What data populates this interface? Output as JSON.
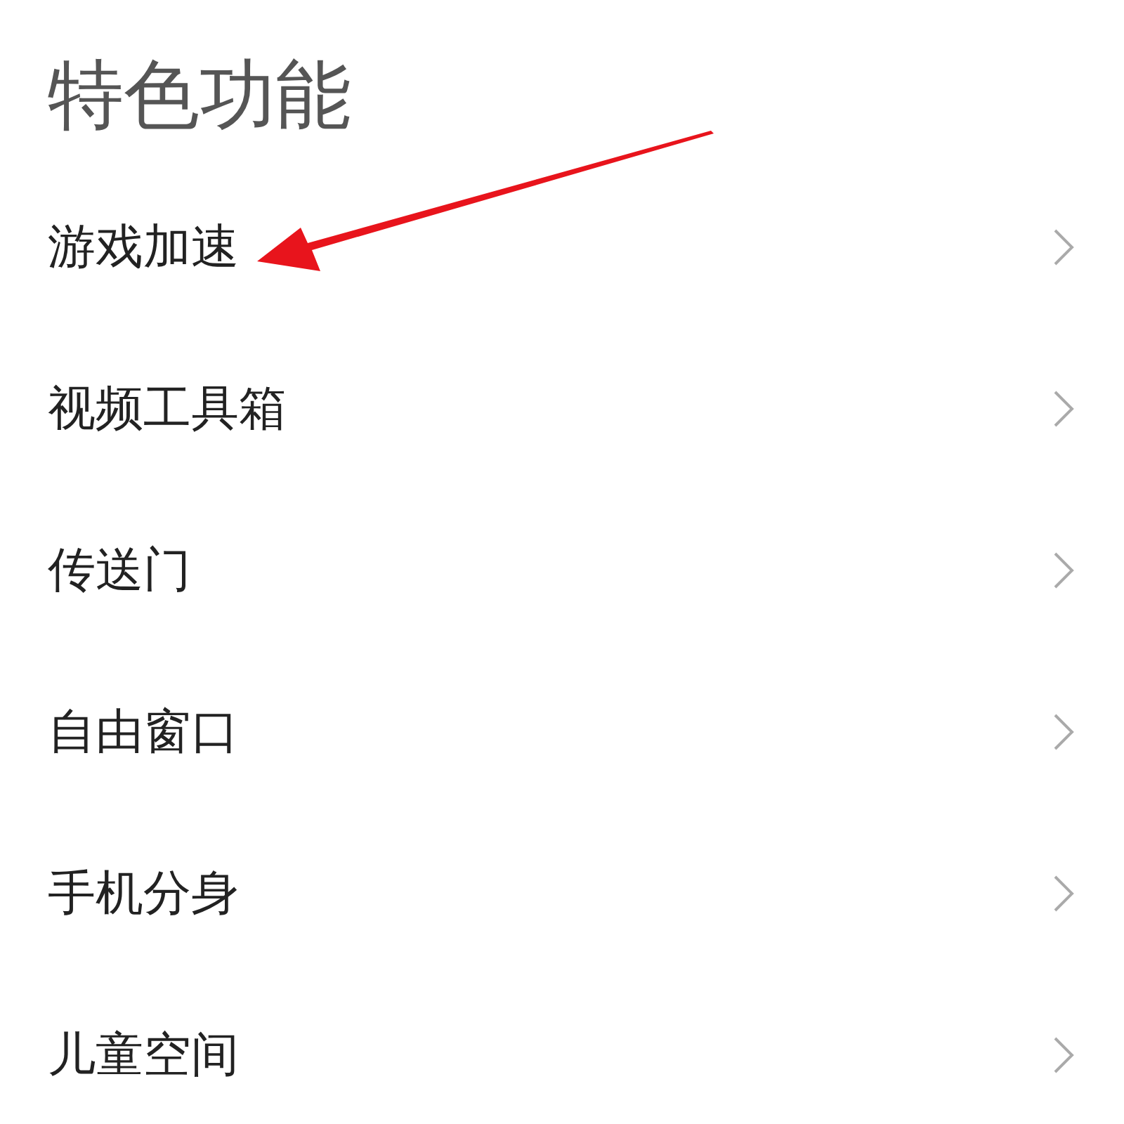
{
  "title": "特色功能",
  "items": [
    {
      "label": "游戏加速"
    },
    {
      "label": "视频工具箱"
    },
    {
      "label": "传送门"
    },
    {
      "label": "自由窗口"
    },
    {
      "label": "手机分身"
    },
    {
      "label": "儿童空间"
    }
  ],
  "annotation": {
    "kind": "arrow"
  }
}
